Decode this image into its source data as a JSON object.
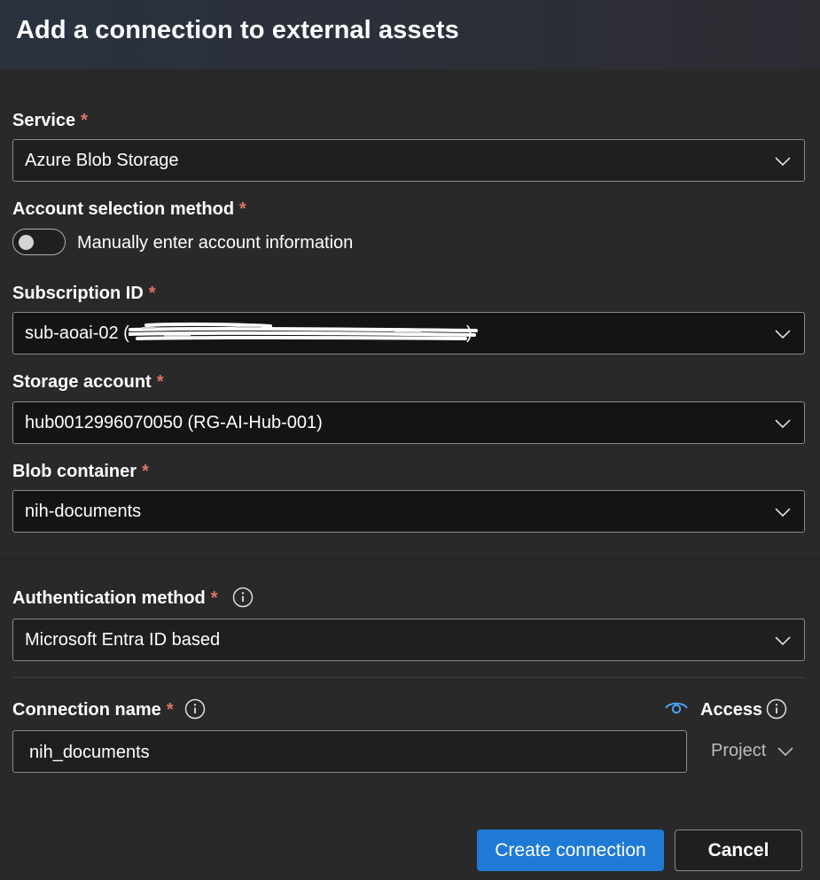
{
  "dialog": {
    "title": "Add a connection to external assets"
  },
  "required_marker": "*",
  "service": {
    "label": "Service",
    "value": "Azure Blob Storage"
  },
  "account_selection": {
    "label": "Account selection method",
    "toggle_label": "Manually enter account information",
    "toggle_on": false
  },
  "subscription": {
    "label": "Subscription ID",
    "value": "sub-aoai-02 (",
    "value_end": ")"
  },
  "storage_account": {
    "label": "Storage account",
    "value": "hub0012996070050 (RG-AI-Hub-001)"
  },
  "blob_container": {
    "label": "Blob container",
    "value": "nih-documents"
  },
  "authentication": {
    "label": "Authentication method",
    "value": "Microsoft Entra ID based"
  },
  "connection_name": {
    "label": "Connection name",
    "value": "nih_documents"
  },
  "access": {
    "label": "Access",
    "value": "Project"
  },
  "buttons": {
    "create": "Create connection",
    "cancel": "Cancel"
  },
  "colors": {
    "accent": "#1f7ad6",
    "required": "#e0736b",
    "background": "#292929"
  },
  "icons": [
    "chevron-down-icon",
    "info-icon",
    "eye-icon"
  ]
}
